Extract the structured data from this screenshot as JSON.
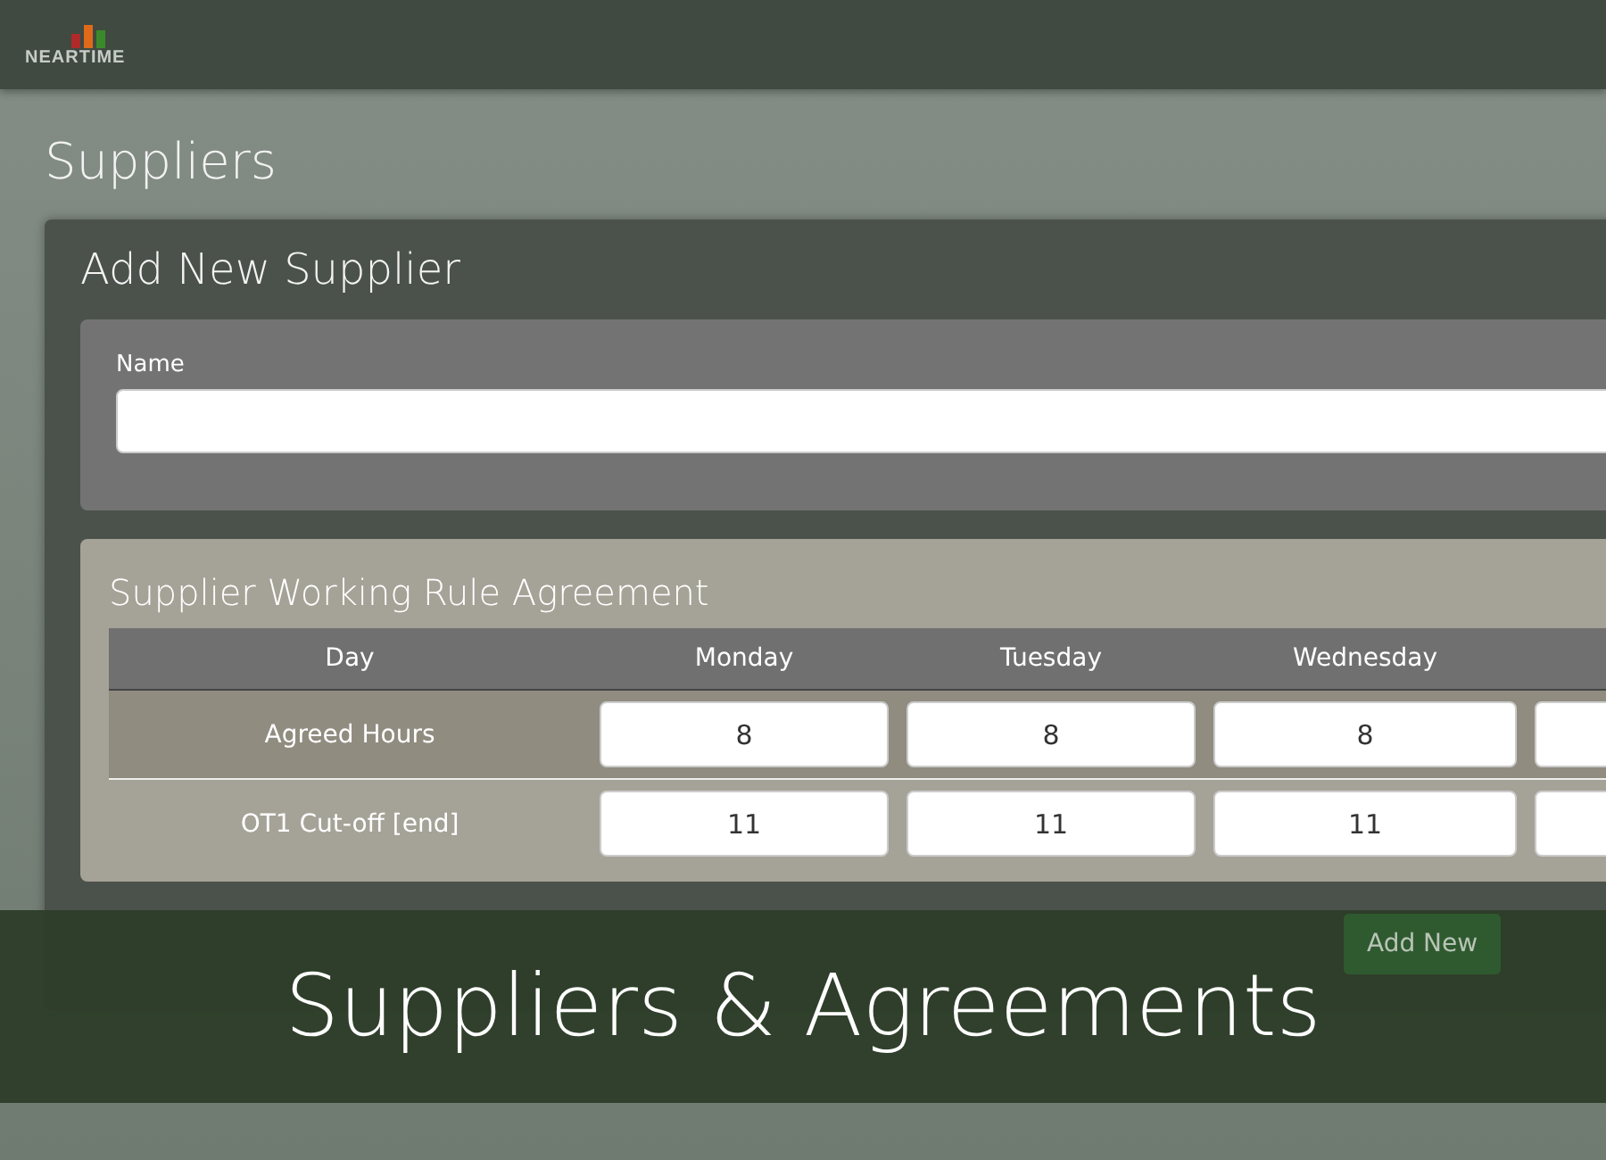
{
  "logo": {
    "text": "NEARTIME"
  },
  "page_title": "Suppliers",
  "card": {
    "title": "Add New Supplier",
    "name_field": {
      "label": "Name"
    },
    "agreement": {
      "title": "Supplier Working Rule Agreement",
      "columns": [
        "Day",
        "Monday",
        "Tuesday",
        "Wednesday"
      ],
      "rows": [
        {
          "label": "Agreed Hours",
          "values": [
            "8",
            "8",
            "8"
          ]
        },
        {
          "label": "OT1 Cut-off [end]",
          "values": [
            "11",
            "11",
            "11"
          ]
        }
      ]
    },
    "add_button": "Add New"
  },
  "banner": {
    "text": "Suppliers & Agreements"
  }
}
